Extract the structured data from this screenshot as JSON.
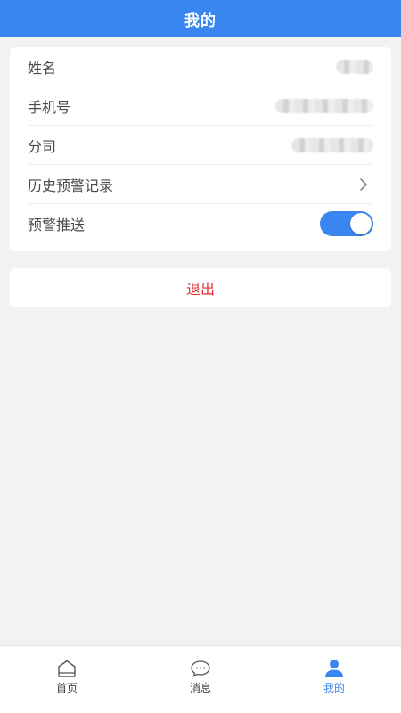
{
  "header": {
    "title": "我的"
  },
  "profile": {
    "name_label": "姓名",
    "phone_label": "手机号",
    "company_label": "分司",
    "history_label": "历史预警记录",
    "push_label": "预警推送",
    "push_enabled": true
  },
  "actions": {
    "logout_label": "退出"
  },
  "tabbar": {
    "items": [
      {
        "label": "首页",
        "icon": "home-icon"
      },
      {
        "label": "消息",
        "icon": "message-icon"
      },
      {
        "label": "我的",
        "icon": "user-icon",
        "active": true
      }
    ]
  },
  "colors": {
    "primary": "#3a86f0",
    "danger": "#e02f2f",
    "background": "#f2f2f2"
  }
}
